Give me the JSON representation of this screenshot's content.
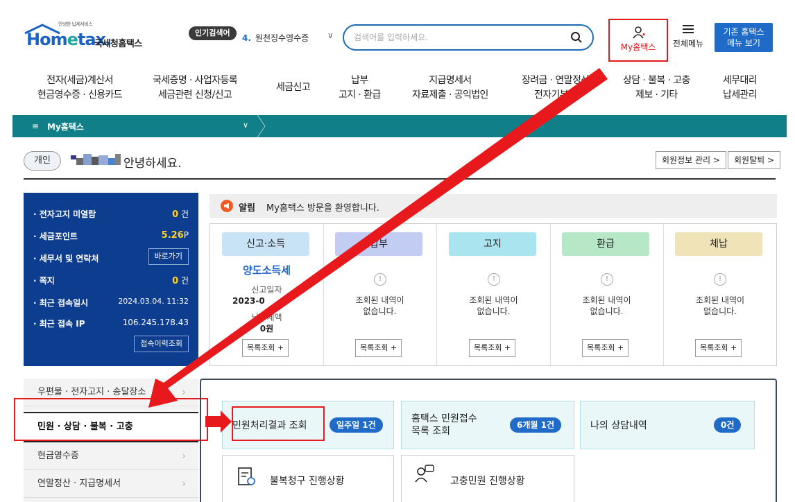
{
  "header": {
    "logo_small": "안녕한 납세서비스",
    "logo_brand_a": "Hom",
    "logo_brand_e": "e",
    "logo_brand_b": "tax.",
    "logo_kr": "국세청홈택스",
    "popular_badge": "인기검색어",
    "popular_num": "4.",
    "popular_text": "원천징수영수증",
    "search_placeholder": "검색어를 입력하세요.",
    "my_hometax": "My홈택스",
    "all_menu": "전체메뉴",
    "old_menu_line1": "기존 홈택스",
    "old_menu_line2": "메뉴 보기"
  },
  "main_nav": [
    {
      "l1": "전자(세금)계산서",
      "l2": "현금영수증 · 신용카드"
    },
    {
      "l1": "국세증명 · 사업자등록",
      "l2": "세금관련 신청/신고"
    },
    {
      "l1": "세금신고",
      "l2": ""
    },
    {
      "l1": "납부",
      "l2": "고지 · 환급"
    },
    {
      "l1": "지급명세서",
      "l2": "자료제출 · 공익법인"
    },
    {
      "l1": "장려금 · 연말정산",
      "l2": "전자기부금"
    },
    {
      "l1": "상담 · 불복 · 고충",
      "l2": "제보 · 기타"
    },
    {
      "l1": "세무대리",
      "l2": "납세관리"
    }
  ],
  "my_bar": {
    "menu_icon": "≡",
    "title": "My홈택스",
    "chevron": "∨"
  },
  "greeting": {
    "type_badge": "개인",
    "text": "안녕하세요.",
    "manage_btn": "회원정보 관리 >",
    "quit_btn": "회원탈퇴 >"
  },
  "info_panel": {
    "unread_label": "· 전자고지 미열람",
    "unread_value": "0",
    "unread_unit": "건",
    "points_label": "· 세금포인트",
    "points_value": "5.26",
    "points_unit": "P",
    "agent_label": "· 세무서 및 연락처",
    "agent_btn": "바로가기",
    "note_label": "· 쪽지",
    "note_value": "0",
    "note_unit": "건",
    "last_login_label": "· 최근 접속일시",
    "last_login_value": "2024.03.04.  11:32",
    "last_ip_label": "· 최근 접속 IP",
    "last_ip_value": "106.245.178.43",
    "history_btn": "접속이력조회"
  },
  "notice": {
    "tag": "알림",
    "message": "My홈택스 방문을 환영합니다."
  },
  "tax_columns": [
    {
      "label": "신고·소득",
      "color": "#c9e3f6",
      "headline": "양도소득세",
      "line1": "신고일자",
      "line2": "2023-0",
      "line3": "납부세액",
      "line4": "0원",
      "button": "목록조회 +"
    },
    {
      "label": "납부",
      "color": "#c3cdf3",
      "empty_line1": "조회된 내역이",
      "empty_line2": "없습니다.",
      "button": "목록조회 +"
    },
    {
      "label": "고지",
      "color": "#a9e4ef",
      "empty_line1": "조회된 내역이",
      "empty_line2": "없습니다.",
      "button": "목록조회 +"
    },
    {
      "label": "환급",
      "color": "#b6e7c7",
      "empty_line1": "조회된 내역이",
      "empty_line2": "없습니다.",
      "button": "목록조회 +"
    },
    {
      "label": "체납",
      "color": "#f0e3b8",
      "empty_line1": "조회된 내역이",
      "empty_line2": "없습니다.",
      "button": "목록조회 +"
    }
  ],
  "side_menu": [
    {
      "label": "우편물 · 전자고지 · 송달장소"
    },
    {
      "label": "민원 · 상담 · 불복 · 고충"
    },
    {
      "label": "현금영수증"
    },
    {
      "label": "연말정산 · 지급명세서"
    }
  ],
  "cards": {
    "c1_text": "민원처리결과 조회",
    "c1_badge": "일주일 1건",
    "c2_text1": "홈택스 민원접수",
    "c2_text2": "목록 조회",
    "c2_badge": "6개월 1건",
    "c3_text": "나의 상담내역",
    "c3_badge": "0건",
    "c4_text": "불복청구 진행상황",
    "c5_text": "고충민원 진행상황"
  },
  "colors": {
    "brand_blue": "#1c63c5",
    "teal_bar": "#107f87",
    "navy_panel": "#0d3d8f",
    "annotation_red": "#e8191c"
  }
}
